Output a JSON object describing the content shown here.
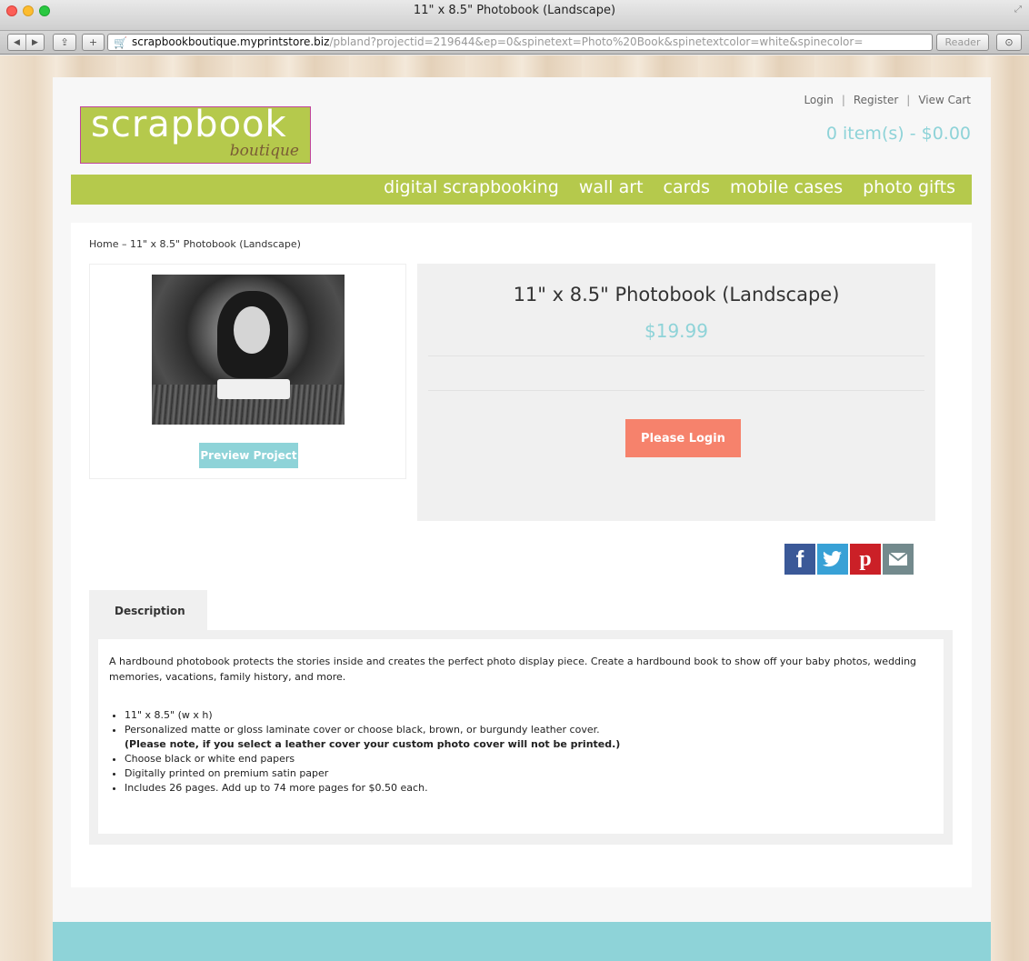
{
  "window": {
    "title": "11\" x 8.5\" Photobook (Landscape)"
  },
  "browser": {
    "url_host": "scrapbookboutique.myprintstore.biz",
    "url_path": "/pbland?projectid=219644&ep=0&spinetext=Photo%20Book&spinetextcolor=white&spinecolor=",
    "reader_label": "Reader"
  },
  "header": {
    "links": [
      "Login",
      "Register",
      "View Cart"
    ],
    "cart_summary": "0 item(s) - $0.00",
    "logo_main": "scrapbook",
    "logo_sub": "boutique"
  },
  "nav": {
    "items": [
      "digital scrapbooking",
      "wall art",
      "cards",
      "mobile cases",
      "photo gifts"
    ]
  },
  "breadcrumb": "Home – 11\" x 8.5\" Photobook (Landscape)",
  "product": {
    "title": "11\" x 8.5\" Photobook (Landscape)",
    "price": "$19.99",
    "preview_label": "Preview Project",
    "login_label": "Please Login"
  },
  "social": [
    "facebook",
    "twitter",
    "pinterest",
    "email"
  ],
  "description": {
    "tab_label": "Description",
    "intro": "A hardbound photobook protects the stories inside and creates the perfect photo display piece. Create a hardbound book to show off your baby photos, wedding memories, vacations, family history, and more.",
    "bullets": [
      "11\" x 8.5\" (w x h)",
      "Personalized matte or gloss laminate cover or choose black, brown, or burgundy leather cover.",
      "Choose black or white end papers",
      "Digitally printed on premium satin paper",
      "Includes 26 pages. Add up to 74 more pages for $0.50 each."
    ],
    "leather_note": "(Please note, if you select a leather cover your custom photo cover will not be printed.)"
  },
  "colors": {
    "green": "#b5c94c",
    "teal": "#8ed3d8",
    "salmon": "#f6826c"
  }
}
